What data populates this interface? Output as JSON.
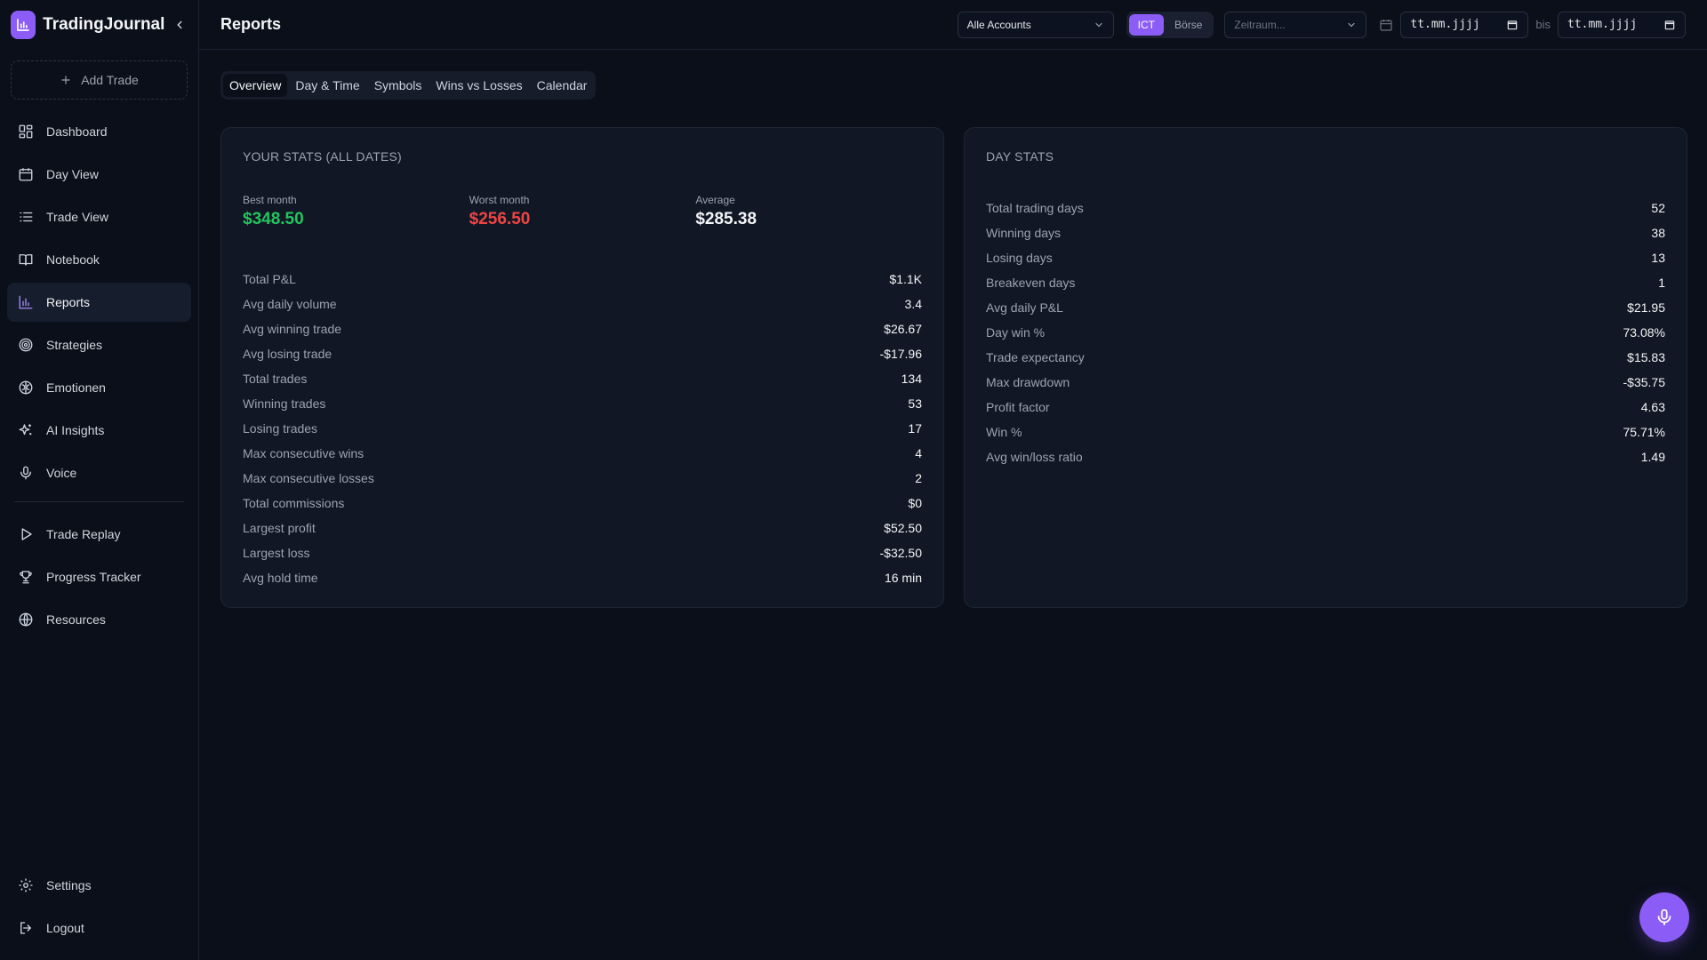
{
  "app": {
    "name": "TradingJournal"
  },
  "sidebar": {
    "add_trade": "Add Trade",
    "items": [
      {
        "label": "Dashboard",
        "icon": "dashboard-icon"
      },
      {
        "label": "Day View",
        "icon": "calendar-icon"
      },
      {
        "label": "Trade View",
        "icon": "list-icon"
      },
      {
        "label": "Notebook",
        "icon": "book-icon"
      },
      {
        "label": "Reports",
        "icon": "bar-chart-icon",
        "active": true
      },
      {
        "label": "Strategies",
        "icon": "target-icon"
      },
      {
        "label": "Emotionen",
        "icon": "brain-icon"
      },
      {
        "label": "AI Insights",
        "icon": "sparkles-icon"
      },
      {
        "label": "Voice",
        "icon": "mic-icon"
      }
    ],
    "secondary": [
      {
        "label": "Trade Replay",
        "icon": "play-icon"
      },
      {
        "label": "Progress Tracker",
        "icon": "trophy-icon"
      },
      {
        "label": "Resources",
        "icon": "globe-icon"
      }
    ],
    "bottom": [
      {
        "label": "Settings",
        "icon": "gear-icon"
      },
      {
        "label": "Logout",
        "icon": "logout-icon"
      }
    ]
  },
  "header": {
    "title": "Reports",
    "accounts_select": "Alle Accounts",
    "mode_options": [
      "ICT",
      "Börse"
    ],
    "mode_selected": "ICT",
    "range_placeholder": "Zeitraum...",
    "date_from": "tt.mm.jjjj",
    "date_sep": "bis",
    "date_to": "tt.mm.jjjj"
  },
  "tabs": [
    "Overview",
    "Day & Time",
    "Symbols",
    "Wins vs Losses",
    "Calendar"
  ],
  "tab_active": "Overview",
  "your_stats": {
    "title": "YOUR STATS (ALL DATES)",
    "best_month": {
      "label": "Best month",
      "value": "$348.50"
    },
    "worst_month": {
      "label": "Worst month",
      "value": "$256.50"
    },
    "average": {
      "label": "Average",
      "value": "$285.38"
    },
    "rows": [
      {
        "label": "Total P&L",
        "value": "$1.1K"
      },
      {
        "label": "Avg daily volume",
        "value": "3.4"
      },
      {
        "label": "Avg winning trade",
        "value": "$26.67"
      },
      {
        "label": "Avg losing trade",
        "value": "-$17.96"
      },
      {
        "label": "Total trades",
        "value": "134"
      },
      {
        "label": "Winning trades",
        "value": "53"
      },
      {
        "label": "Losing trades",
        "value": "17"
      },
      {
        "label": "Max consecutive wins",
        "value": "4"
      },
      {
        "label": "Max consecutive losses",
        "value": "2"
      },
      {
        "label": "Total commissions",
        "value": "$0"
      },
      {
        "label": "Largest profit",
        "value": "$52.50"
      },
      {
        "label": "Largest loss",
        "value": "-$32.50"
      },
      {
        "label": "Avg hold time",
        "value": "16 min"
      }
    ]
  },
  "day_stats": {
    "title": "DAY STATS",
    "rows": [
      {
        "label": "Total trading days",
        "value": "52"
      },
      {
        "label": "Winning days",
        "value": "38"
      },
      {
        "label": "Losing days",
        "value": "13"
      },
      {
        "label": "Breakeven days",
        "value": "1"
      },
      {
        "label": "Avg daily P&L",
        "value": "$21.95"
      },
      {
        "label": "Day win %",
        "value": "73.08%"
      },
      {
        "label": "Trade expectancy",
        "value": "$15.83"
      },
      {
        "label": "Max drawdown",
        "value": "-$35.75"
      },
      {
        "label": "Profit factor",
        "value": "4.63"
      },
      {
        "label": "Win %",
        "value": "75.71%"
      },
      {
        "label": "Avg win/loss ratio",
        "value": "1.49"
      }
    ]
  },
  "colors": {
    "accent": "#8b5cf6",
    "positive": "#22c55e",
    "negative": "#ef4444",
    "background": "#0b0f1a",
    "card": "#111725"
  }
}
